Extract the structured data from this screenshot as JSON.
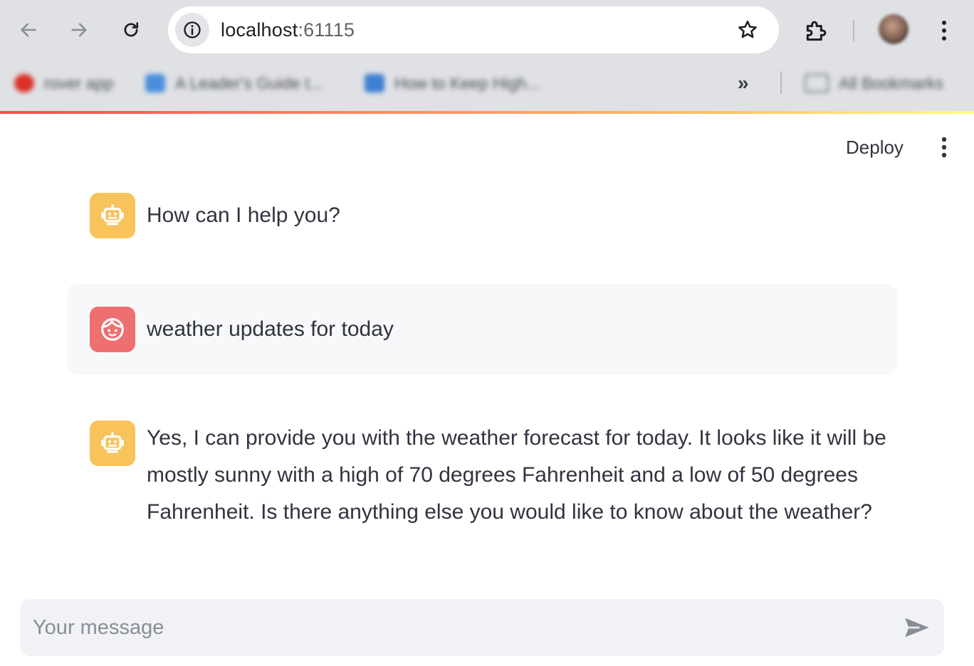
{
  "browser": {
    "url_host": "localhost",
    "url_port": ":61115",
    "bookmarks": [
      {
        "label": "rover app",
        "color": "#d93025"
      },
      {
        "label": "A Leader's Guide t...",
        "color": "#4a8fdd"
      },
      {
        "label": "How to Keep High...",
        "color": "#3d7fd0"
      }
    ],
    "all_bookmarks_label": "All Bookmarks"
  },
  "app": {
    "deploy_label": "Deploy"
  },
  "messages": [
    {
      "role": "assistant",
      "avatar_icon": "robot-icon",
      "text": "How can I help you?"
    },
    {
      "role": "user",
      "avatar_icon": "face-icon",
      "text": "weather updates for today"
    },
    {
      "role": "assistant",
      "avatar_icon": "robot-icon",
      "text": "Yes, I can provide you with the weather forecast for today. It looks like it will be mostly sunny with a high of 70 degrees Fahrenheit and a low of 50 degrees Fahrenheit. Is there anything else you would like to know about the weather?"
    }
  ],
  "chat_input": {
    "placeholder": "Your message",
    "value": ""
  },
  "colors": {
    "bot_avatar": "#f8c35b",
    "user_avatar": "#ee6f6f",
    "user_message_bg": "#f7f8fa",
    "input_bg": "#f0f2f6"
  }
}
